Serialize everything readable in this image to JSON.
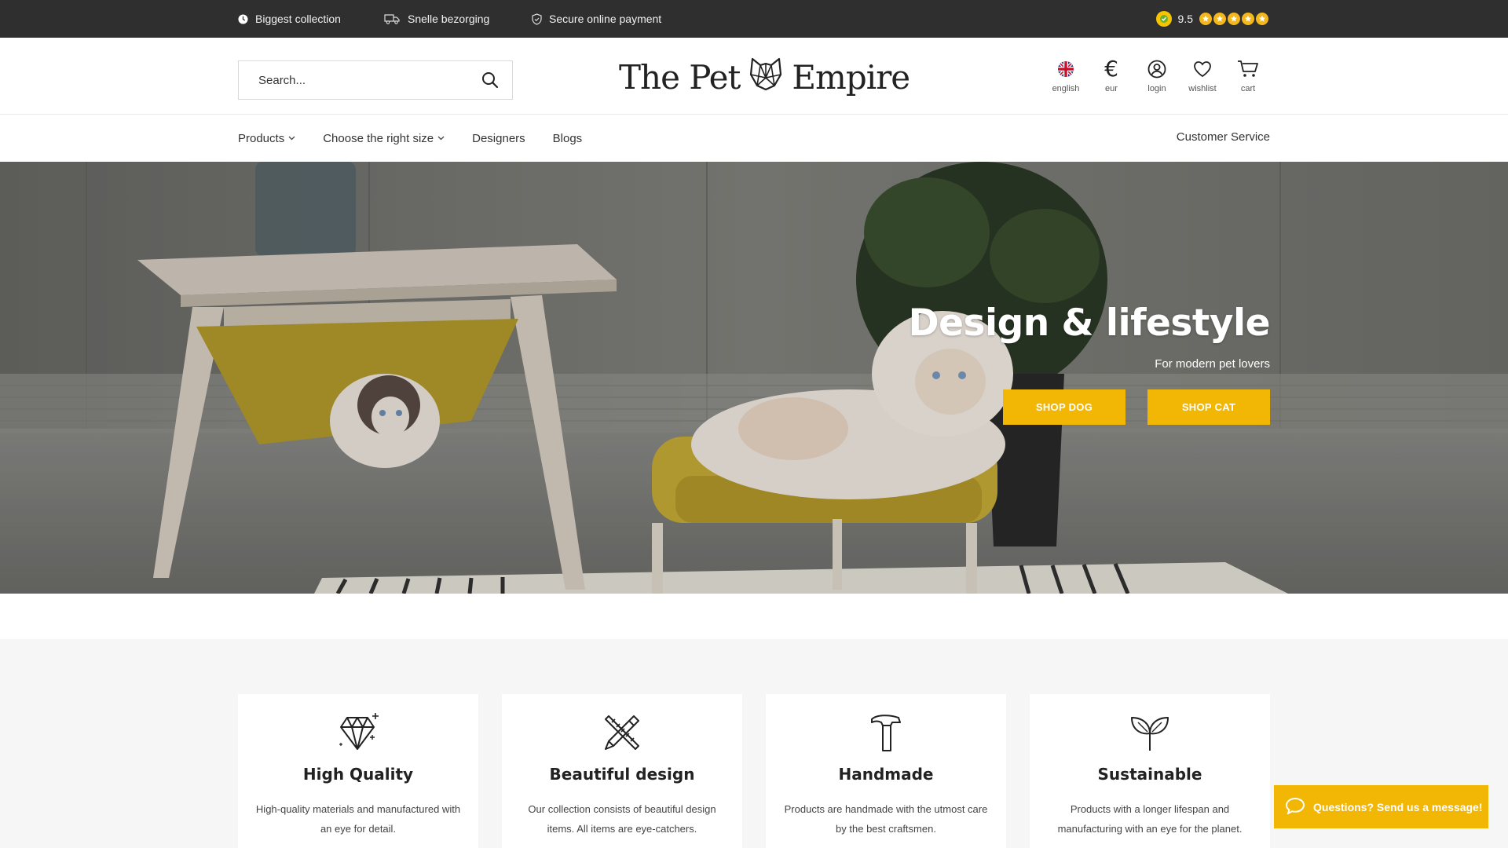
{
  "topbar": {
    "usps": [
      {
        "icon": "clock-icon",
        "label": "Biggest collection"
      },
      {
        "icon": "truck-icon",
        "label": "Snelle bezorging"
      },
      {
        "icon": "shield-icon",
        "label": "Secure online payment"
      }
    ],
    "rating": {
      "score": "9.5",
      "stars": 5
    }
  },
  "header": {
    "search": {
      "placeholder": "Search..."
    },
    "logo": {
      "left": "The Pet",
      "right": "Empire"
    },
    "icons": [
      {
        "icon": "uk-flag-icon",
        "label": "english"
      },
      {
        "icon": "euro-icon",
        "label": "eur",
        "glyph": "€"
      },
      {
        "icon": "user-icon",
        "label": "login"
      },
      {
        "icon": "heart-icon",
        "label": "wishlist"
      },
      {
        "icon": "cart-icon",
        "label": "cart"
      }
    ]
  },
  "nav": {
    "items": [
      {
        "label": "Products",
        "dropdown": true
      },
      {
        "label": "Choose the right size",
        "dropdown": true
      },
      {
        "label": "Designers",
        "dropdown": false
      },
      {
        "label": "Blogs",
        "dropdown": false
      }
    ],
    "right": "Customer Service"
  },
  "hero": {
    "title": "Design & lifestyle",
    "subtitle": "For modern pet lovers",
    "buttons": [
      "SHOP DOG",
      "SHOP CAT"
    ]
  },
  "usps": [
    {
      "icon": "diamond-icon",
      "title": "High Quality",
      "text": "High-quality materials and manufactured with an eye for detail."
    },
    {
      "icon": "pencil-ruler-icon",
      "title": "Beautiful design",
      "text": "Our collection consists of beautiful design items. All items are eye-catchers."
    },
    {
      "icon": "hammer-icon",
      "title": "Handmade",
      "text": "Products are handmade with the utmost care by the best craftsmen."
    },
    {
      "icon": "sprout-icon",
      "title": "Sustainable",
      "text": "Products with a longer lifespan and manufacturing with an eye for the planet."
    }
  ],
  "chat": {
    "label": "Questions? Send us a message!"
  },
  "colors": {
    "accent": "#f2b705",
    "topbar": "#2f2f2f",
    "section_bg": "#f6f6f6"
  }
}
